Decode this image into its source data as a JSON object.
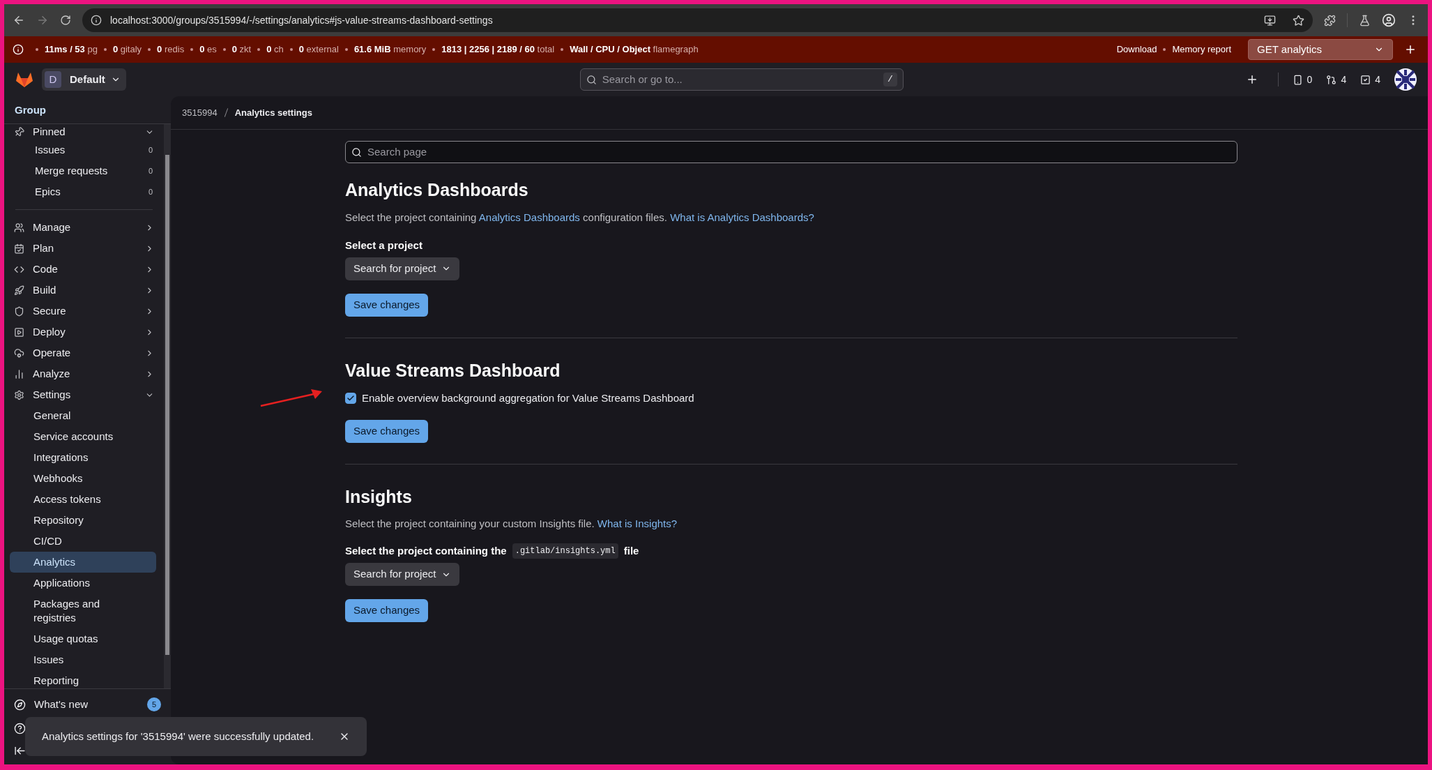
{
  "browser": {
    "url": "localhost:3000/groups/3515994/-/settings/analytics#js-value-streams-dashboard-settings"
  },
  "perf_bar": {
    "items": [
      "**11ms / 53** pg",
      "**0** gitaly",
      "**0** redis",
      "**0** es",
      "**0** zkt",
      "**0** ch",
      "**0** external",
      "**61.6 MiB** memory",
      "**1813 | 2256 | 2189 / 60** total",
      "**Wall / CPU / Object** flamegraph"
    ],
    "links": [
      "Download",
      "Memory report"
    ],
    "request_select": "GET analytics"
  },
  "header": {
    "group_initial": "D",
    "group_name": "Default",
    "search_placeholder": "Search or go to...",
    "search_shortcut": "/",
    "counts": [
      "0",
      "4",
      "4"
    ]
  },
  "sidebar": {
    "title": "Group",
    "pinned": {
      "label": "Pinned",
      "expanded": true,
      "items": [
        {
          "label": "Issues",
          "count": "0"
        },
        {
          "label": "Merge requests",
          "count": "0"
        },
        {
          "label": "Epics",
          "count": "0"
        }
      ]
    },
    "sections": [
      {
        "label": "Manage",
        "expanded": false
      },
      {
        "label": "Plan",
        "expanded": false
      },
      {
        "label": "Code",
        "expanded": false
      },
      {
        "label": "Build",
        "expanded": false
      },
      {
        "label": "Secure",
        "expanded": false
      },
      {
        "label": "Deploy",
        "expanded": false
      },
      {
        "label": "Operate",
        "expanded": false
      },
      {
        "label": "Analyze",
        "expanded": false
      },
      {
        "label": "Settings",
        "expanded": true,
        "children": [
          {
            "label": "General",
            "selected": false
          },
          {
            "label": "Service accounts",
            "selected": false
          },
          {
            "label": "Integrations",
            "selected": false
          },
          {
            "label": "Webhooks",
            "selected": false
          },
          {
            "label": "Access tokens",
            "selected": false
          },
          {
            "label": "Repository",
            "selected": false
          },
          {
            "label": "CI/CD",
            "selected": false
          },
          {
            "label": "Analytics",
            "selected": true
          },
          {
            "label": "Applications",
            "selected": false
          },
          {
            "label": "Packages and registries",
            "selected": false
          },
          {
            "label": "Usage quotas",
            "selected": false
          },
          {
            "label": "Issues",
            "selected": false
          },
          {
            "label": "Reporting",
            "selected": false
          }
        ]
      }
    ],
    "whats_new": {
      "label": "What's new",
      "badge": "5"
    }
  },
  "breadcrumb": [
    "3515994",
    "Analytics settings"
  ],
  "search": {
    "placeholder": "Search page"
  },
  "analytics_dashboards": {
    "title": "Analytics Dashboards",
    "description": [
      {
        "kind": "text",
        "text": "Select the project containing "
      },
      {
        "kind": "link",
        "text": "Analytics Dashboards"
      },
      {
        "kind": "text",
        "text": " configuration files. "
      },
      {
        "kind": "link",
        "text": "What is Analytics Dashboards?"
      }
    ],
    "label": "Select a project",
    "dropdown": "Search for project",
    "button": "Save changes"
  },
  "value_streams": {
    "title": "Value Streams Dashboard",
    "checkbox": {
      "label": "Enable overview background aggregation for Value Streams Dashboard",
      "checked": true
    },
    "button": "Save changes"
  },
  "insights": {
    "title": "Insights",
    "description": "Select the project containing your custom Insights file.",
    "link": "What is Insights?",
    "label_before": "Select the project containing the",
    "code": ".gitlab/insights.yml",
    "label_after": "file",
    "dropdown": "Search for project",
    "button": "Save changes"
  },
  "toast": {
    "message": "Analytics settings for '3515994' were successfully updated."
  }
}
